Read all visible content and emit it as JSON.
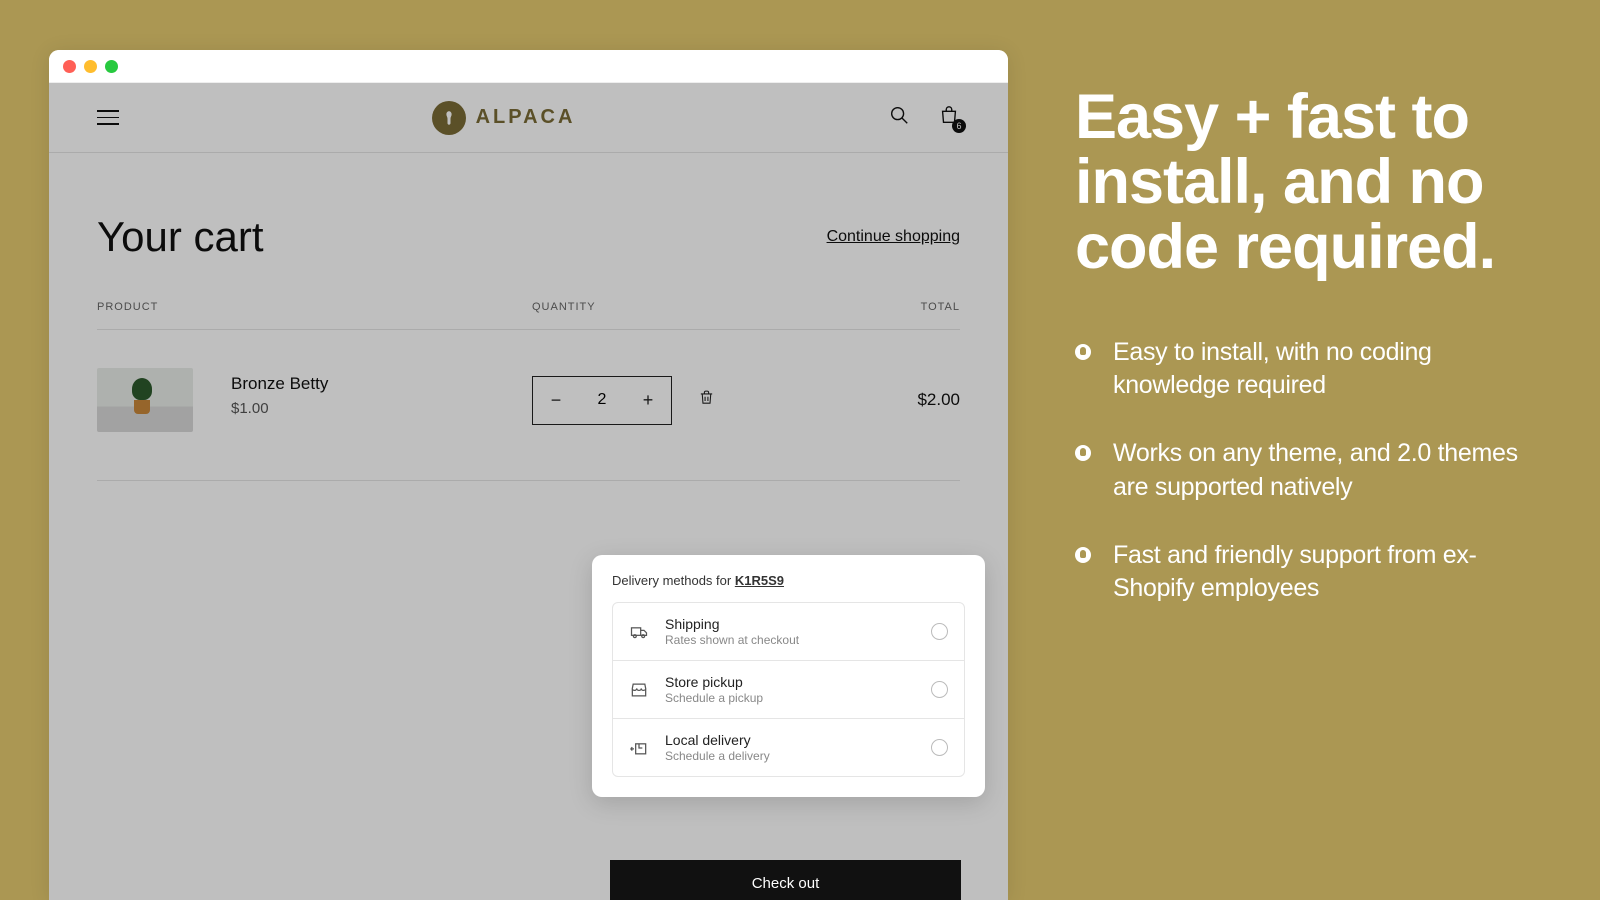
{
  "brand_name": "ALPACA",
  "header": {
    "bag_count": "6"
  },
  "cart": {
    "title": "Your cart",
    "continue_label": "Continue shopping",
    "columns": {
      "product": "PRODUCT",
      "quantity": "QUANTITY",
      "total": "TOTAL"
    },
    "line": {
      "name": "Bronze Betty",
      "unit_price": "$1.00",
      "qty": "2",
      "total": "$2.00"
    }
  },
  "delivery": {
    "title_prefix": "Delivery methods for ",
    "postal_code": "K1R5S9",
    "methods": [
      {
        "name": "Shipping",
        "sub": "Rates shown at checkout"
      },
      {
        "name": "Store pickup",
        "sub": "Schedule a pickup"
      },
      {
        "name": "Local delivery",
        "sub": "Schedule a delivery"
      }
    ]
  },
  "checkout_label": "Check out",
  "marketing": {
    "headline": "Easy + fast to install, and no code required.",
    "bullets": [
      "Easy to install, with no coding knowledge required",
      "Works on any theme, and 2.0 themes are supported natively",
      "Fast and friendly support from ex-Shopify employees"
    ]
  }
}
